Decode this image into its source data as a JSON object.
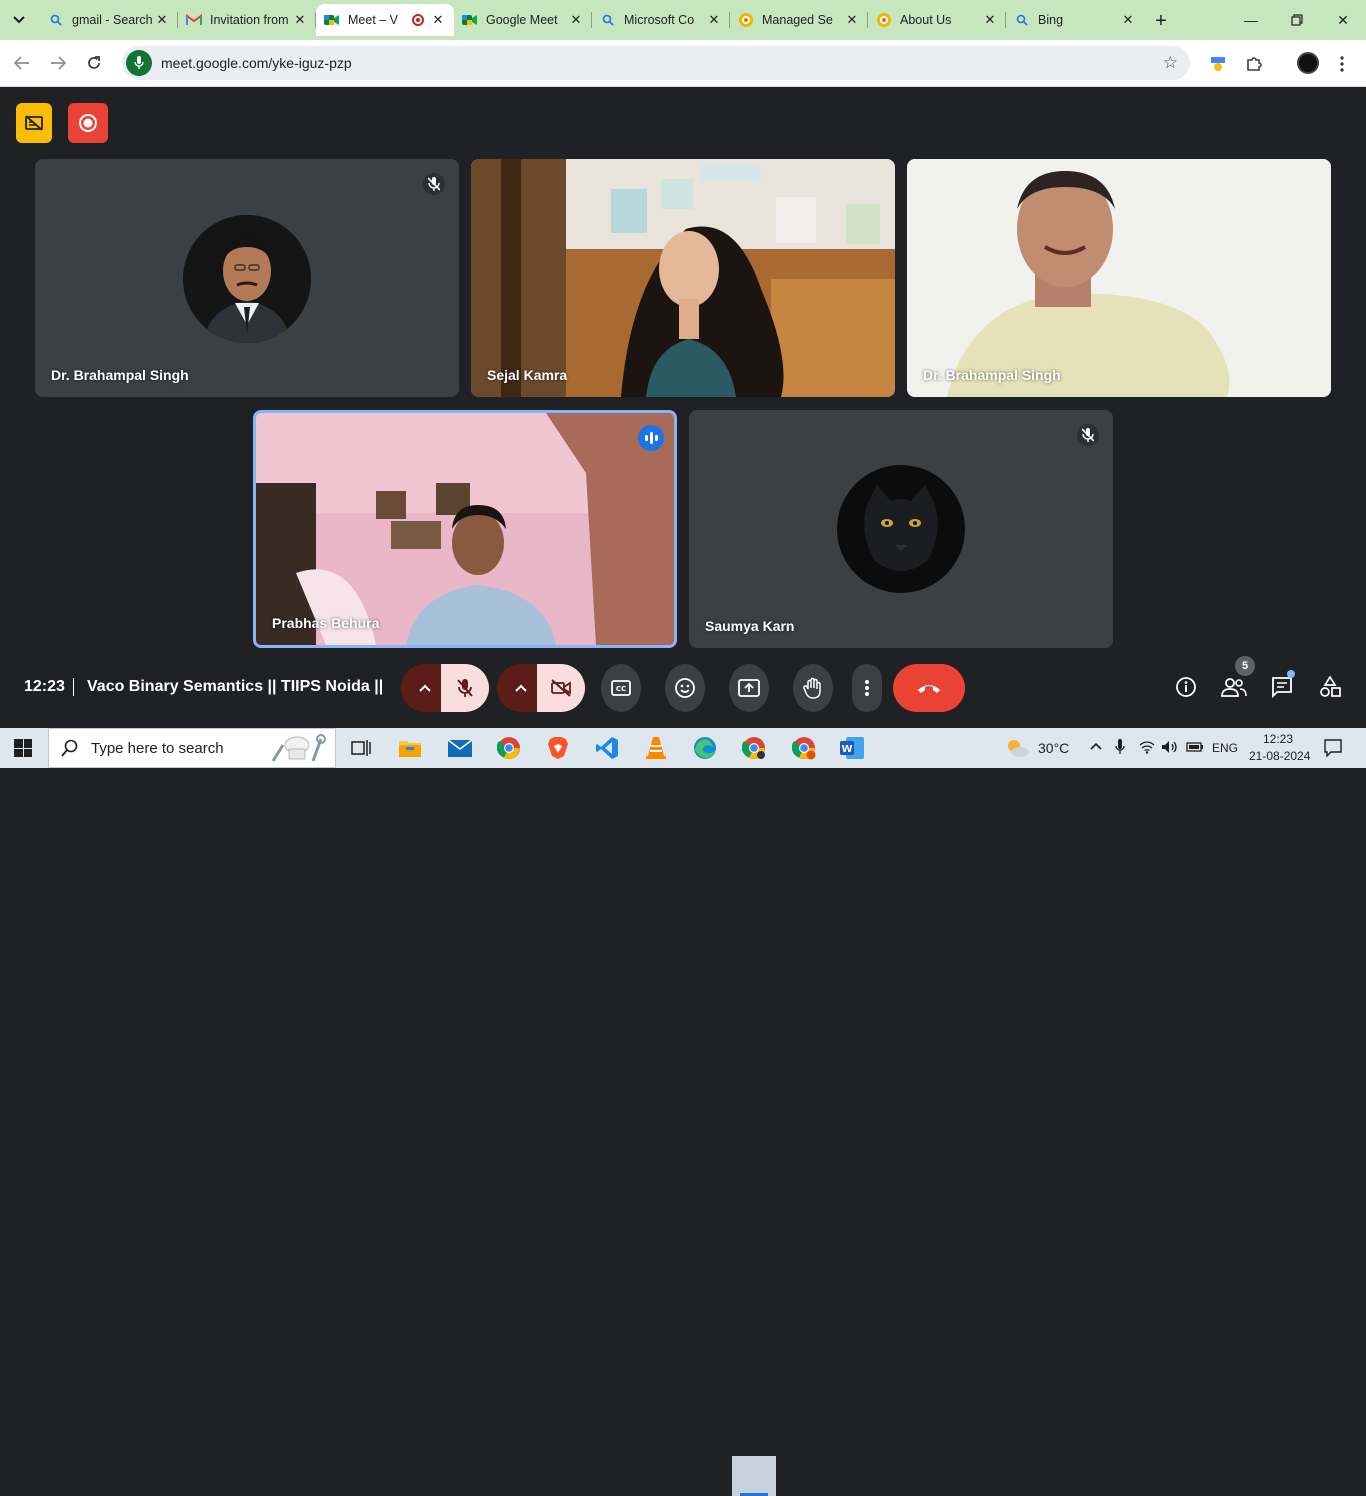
{
  "browser": {
    "tabs": [
      {
        "title": "gmail - Search",
        "icon": "search-icon"
      },
      {
        "title": "Invitation from",
        "icon": "gmail-icon"
      },
      {
        "title": "Meet – V",
        "icon": "meet-icon",
        "active": true,
        "recording": true
      },
      {
        "title": "Google Meet",
        "icon": "meet-icon"
      },
      {
        "title": "Microsoft Co",
        "icon": "search-icon"
      },
      {
        "title": "Managed Se",
        "icon": "web-icon"
      },
      {
        "title": "About Us",
        "icon": "web-icon"
      },
      {
        "title": "Bing",
        "icon": "search-icon"
      }
    ],
    "url": "meet.google.com/yke-iguz-pzp"
  },
  "meet": {
    "participants": [
      {
        "name": "Dr. Brahampal Singh",
        "muted": true,
        "type": "avatar"
      },
      {
        "name": "Sejal Kamra",
        "muted": false,
        "type": "video"
      },
      {
        "name": "Dr. Brahampal Singh",
        "muted": false,
        "type": "video"
      },
      {
        "name": "Prabhas Behura",
        "muted": false,
        "type": "video",
        "speaking": true
      },
      {
        "name": "Saumya Karn",
        "muted": true,
        "type": "avatar"
      }
    ],
    "clock": "12:23",
    "meeting_title": "Vaco Binary Semantics || TIIPS Noida ||",
    "people_count": "5",
    "colors": {
      "end_call": "#ea4335",
      "background": "#202124",
      "speaking": "#1a73e8"
    }
  },
  "taskbar": {
    "search_placeholder": "Type here to search",
    "weather": "30°C",
    "language": "ENG",
    "time": "12:23",
    "date": "21-08-2024"
  }
}
